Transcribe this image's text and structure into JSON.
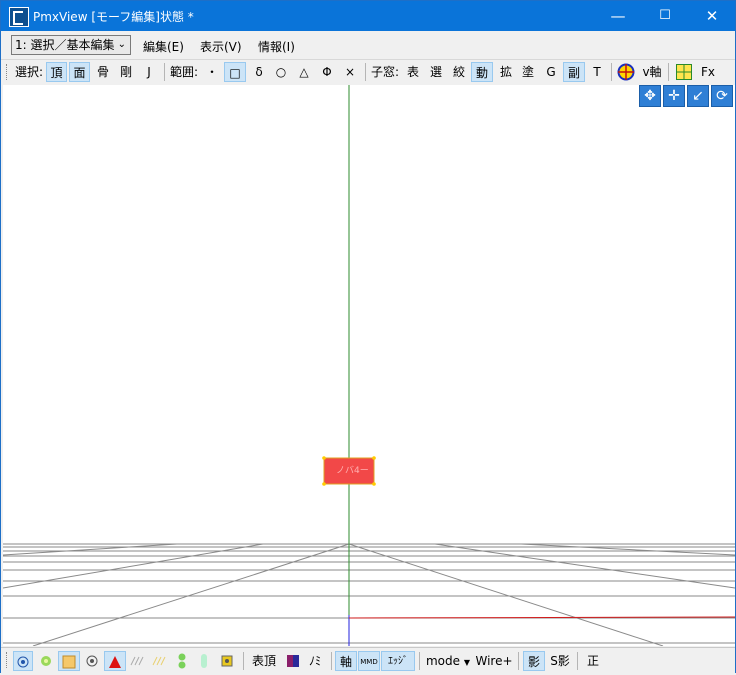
{
  "window": {
    "title": "PmxView  [モーフ編集]状態 *",
    "minimize": "—",
    "maximize": "☐",
    "close": "✕"
  },
  "menubar": {
    "mode_select": "1: 選択／基本編集",
    "items": [
      "編集(E)",
      "表示(V)",
      "情報(I)"
    ]
  },
  "toolbar": {
    "select_label": "選択:",
    "select_items": [
      "頂",
      "面",
      "骨",
      "剛",
      "J"
    ],
    "range_label": "範囲:",
    "range_items": [
      "・",
      "□",
      "δ",
      "○",
      "△",
      "Φ",
      "×"
    ],
    "child_label": "子窓:",
    "child_items": [
      "表",
      "選",
      "絞",
      "動",
      "拡",
      "塗",
      "G",
      "副",
      "T"
    ],
    "v_axis": "v軸",
    "fx": "Fx"
  },
  "viewport": {
    "morph_label": "ノバ4ー",
    "nav_icons": [
      "move-all-icon",
      "move-xy-icon",
      "move-z-icon",
      "rotate-icon"
    ]
  },
  "statusbar": {
    "vertex_label": "表頂",
    "nomi": "ﾉﾐ",
    "axis": "軸",
    "mmd": "MMD",
    "edge": "ｴｯｼﾞ",
    "mode": "mode",
    "wire": "Wire+",
    "shadow": "影",
    "s_shadow": "S影",
    "ortho": "正"
  },
  "colors": {
    "titlebar": "#0a74d9",
    "grid": "#808080",
    "y_axis": "#2e8b2e",
    "x_axis": "#d01c1c",
    "z_axis": "#2222dd",
    "morph_fill": "#f24848"
  }
}
